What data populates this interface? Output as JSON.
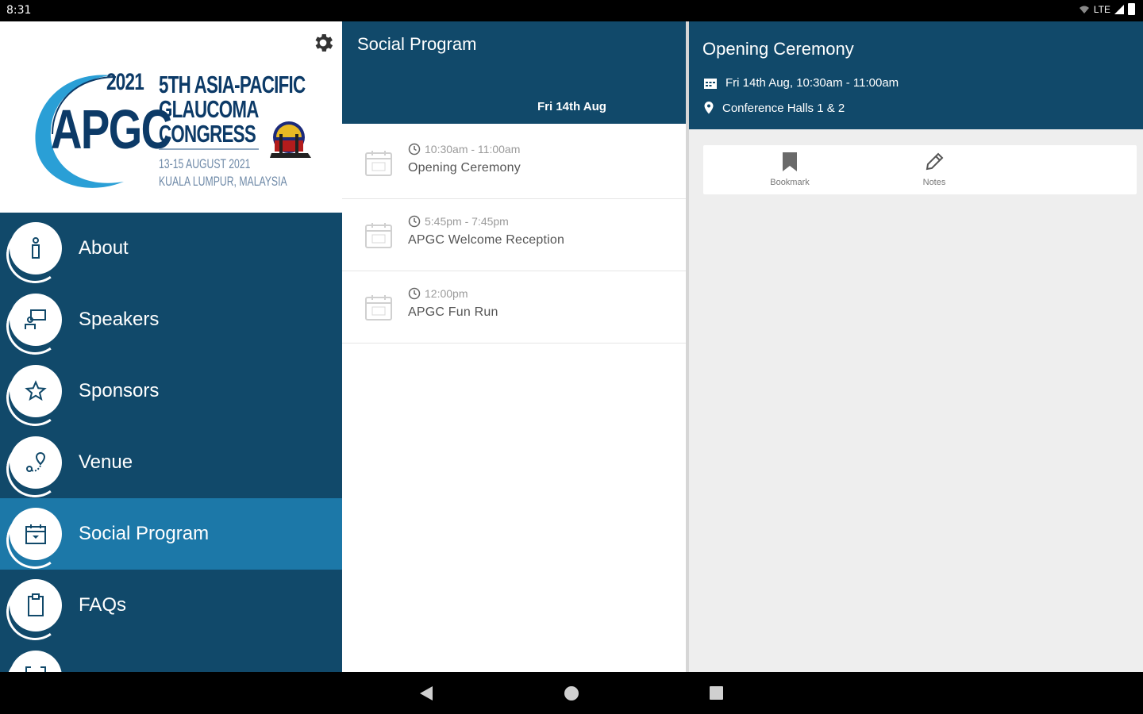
{
  "status": {
    "time": "8:31",
    "network": "LTE"
  },
  "logo": {
    "year": "2021",
    "acronym": "APGC",
    "line1": "5TH ASIA-PACIFIC",
    "line2": "GLAUCOMA",
    "line3": "CONGRESS",
    "dates": "13-15 AUGUST 2021",
    "location": "KUALA LUMPUR, MALAYSIA"
  },
  "sidebar": {
    "items": [
      {
        "label": "About",
        "icon": "info-icon",
        "active": false
      },
      {
        "label": "Speakers",
        "icon": "speaker-icon",
        "active": false
      },
      {
        "label": "Sponsors",
        "icon": "star-icon",
        "active": false
      },
      {
        "label": "Venue",
        "icon": "map-pin-icon",
        "active": false
      },
      {
        "label": "Social Program",
        "icon": "calendar-icon",
        "active": true
      },
      {
        "label": "FAQs",
        "icon": "clipboard-icon",
        "active": false
      }
    ]
  },
  "list": {
    "title": "Social Program",
    "tab": "Fri 14th Aug",
    "items": [
      {
        "time": "10:30am - 11:00am",
        "title": "Opening Ceremony"
      },
      {
        "time": "5:45pm - 7:45pm",
        "title": "APGC Welcome Reception"
      },
      {
        "time": "12:00pm",
        "title": "APGC Fun Run"
      }
    ]
  },
  "detail": {
    "title": "Opening Ceremony",
    "datetime": "Fri 14th Aug, 10:30am - 11:00am",
    "location": "Conference Halls 1 & 2",
    "actions": {
      "bookmark": "Bookmark",
      "notes": "Notes"
    }
  },
  "colors": {
    "primary": "#11496a",
    "active": "#1c78a8",
    "background": "#eeeeee"
  }
}
